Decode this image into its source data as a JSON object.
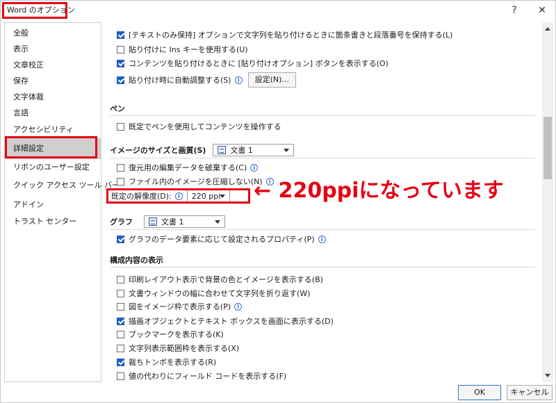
{
  "window": {
    "title": "Word のオプション",
    "help_label": "?",
    "close_label": "✕"
  },
  "sidebar": {
    "items": [
      {
        "label": "全般"
      },
      {
        "label": "表示"
      },
      {
        "label": "文章校正"
      },
      {
        "label": "保存"
      },
      {
        "label": "文字体裁"
      },
      {
        "label": "言語"
      },
      {
        "label": "アクセシビリティ"
      },
      {
        "label": "詳細設定"
      },
      {
        "label": "リボンのユーザー設定"
      },
      {
        "label": "クイック アクセス ツール バー"
      },
      {
        "label": "アドイン"
      },
      {
        "label": "トラスト センター"
      }
    ],
    "selected": "詳細設定"
  },
  "paste": {
    "opt_keep_bullets": "[テキストのみ保持] オプションで文字列を貼り付けるときに箇条書きと段落番号を保持する(L)",
    "opt_ins_key": "貼り付けに Ins キーを使用する(U)",
    "opt_show_paste_button": "コンテンツを貼り付けるときに [貼り付けオプション] ボタンを表示する(O)",
    "opt_auto_adjust": "貼り付け時に自動調整する(S)",
    "settings_button": "設定(N)..."
  },
  "pen": {
    "heading": "ペン",
    "opt_use_pen": "既定でペンを使用してコンテンツを操作する"
  },
  "image_size": {
    "heading": "イメージのサイズと画質(S)",
    "document": "文書 1",
    "opt_discard_edit_data": "復元用の編集データを破棄する(C)",
    "opt_no_compress": "ファイル内のイメージを圧縮しない(N)",
    "resolution_label": "既定の解像度(D):",
    "resolution_value": "220 ppi"
  },
  "annotation": "← 220ppiになっています",
  "graph": {
    "heading": "グラフ",
    "document": "文書 1",
    "opt_properties": "グラフのデータ要素に応じて設定されるプロパティ(P)"
  },
  "display": {
    "heading": "構成内容の表示",
    "options": [
      {
        "label": "印刷レイアウト表示で背景の色とイメージを表示する(B)",
        "checked": false,
        "info": false
      },
      {
        "label": "文書ウィンドウの幅に合わせて文字列を折り返す(W)",
        "checked": false,
        "info": false
      },
      {
        "label": "図をイメージ枠で表示する(P)",
        "checked": false,
        "info": true
      },
      {
        "label": "描画オブジェクトとテキスト ボックスを画面に表示する(D)",
        "checked": true,
        "info": false
      },
      {
        "label": "ブックマークを表示する(K)",
        "checked": false,
        "info": false
      },
      {
        "label": "文字列表示範囲枠を表示する(X)",
        "checked": false,
        "info": false
      },
      {
        "label": "裁ちトンボを表示する(R)",
        "checked": true,
        "info": false
      },
      {
        "label": "値の代わりにフィールド コードを表示する(F)",
        "checked": false,
        "info": false
      }
    ]
  },
  "footer": {
    "ok_label": "OK",
    "cancel_label": "キャンセル"
  },
  "colors": {
    "highlight": "#e60012",
    "checkbox_checked": "#1f5fbf"
  }
}
